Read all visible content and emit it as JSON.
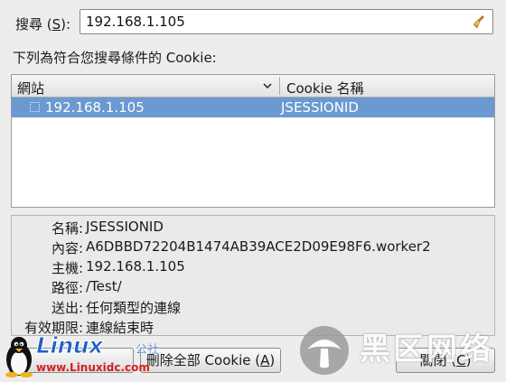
{
  "search": {
    "label_text": "搜尋 (",
    "label_key": "S",
    "label_end": "):",
    "value": "192.168.1.105"
  },
  "list": {
    "caption": "下列為符合您搜尋條件的 Cookie:",
    "columns": {
      "site": "網站",
      "name": "Cookie 名稱"
    },
    "rows": [
      {
        "site": "192.168.1.105",
        "name": "JSESSIONID",
        "selected": true
      }
    ]
  },
  "details": [
    {
      "label": "名稱:",
      "value": "JSESSIONID"
    },
    {
      "label": "內容:",
      "value": "A6DBBD72204B1474AB39ACE2D09E98F6.worker2"
    },
    {
      "label": "主機:",
      "value": "192.168.1.105"
    },
    {
      "label": "路徑:",
      "value": "/Test/"
    },
    {
      "label": "送出:",
      "value": "任何類型的連線"
    },
    {
      "label": "有效期限:",
      "value": "連線結束時"
    }
  ],
  "buttons": {
    "remove_all_text": "刪除全部 Cookie (",
    "remove_all_key": "A",
    "remove_all_end": ")",
    "close_text": "關閉 (",
    "close_key": "C",
    "close_end": ")"
  },
  "watermarks": {
    "linux_logo": "Linux",
    "linux_sub": "公社",
    "linux_url": "www.Linuxidc.com",
    "site_name": "黑区网络"
  },
  "colors": {
    "selection": "#6b99d1",
    "window_bg": "#ededed",
    "watermark_blue": "#1f5fc8",
    "watermark_red": "#d22020"
  },
  "icons": [
    "broom-icon",
    "sort-chevron-icon",
    "row-checkbox",
    "tux-penguin-icon",
    "mushroom-badge-icon"
  ]
}
